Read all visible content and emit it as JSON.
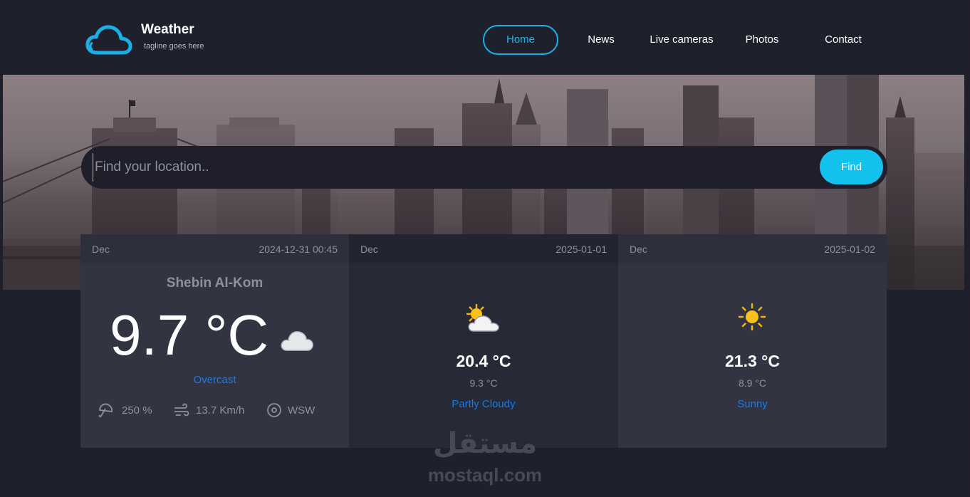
{
  "brand": {
    "title": "Weather",
    "tagline": "tagline goes here",
    "logo_icon": "cloud-icon",
    "accent": "#1ab0e6"
  },
  "nav": {
    "items": [
      {
        "label": "Home",
        "active": true
      },
      {
        "label": "News",
        "active": false
      },
      {
        "label": "Live cameras",
        "active": false
      },
      {
        "label": "Photos",
        "active": false
      },
      {
        "label": "Contact",
        "active": false
      }
    ]
  },
  "search": {
    "placeholder": "Find your location..",
    "button_label": "Find",
    "button_color": "#12c1ec"
  },
  "today": {
    "day": "Dec",
    "datetime": "2024-12-31 00:45",
    "city": "Shebin Al-Kom",
    "temp": "9.7 °C",
    "condition": "Overcast",
    "icon": "cloud-icon",
    "humidity": "250 %",
    "wind_speed": "13.7 Km/h",
    "wind_dir": "WSW"
  },
  "forecast": [
    {
      "day": "Dec",
      "date": "2025-01-01",
      "max": "20.4 °C",
      "min": "9.3 °C",
      "condition": "Partly Cloudy",
      "icon": "partly-cloudy-icon"
    },
    {
      "day": "Dec",
      "date": "2025-01-02",
      "max": "21.3 °C",
      "min": "8.9 °C",
      "condition": "Sunny",
      "icon": "sun-icon"
    }
  ],
  "watermark": {
    "arabic": "مستقل",
    "latin": "mostaql.com"
  },
  "colors": {
    "background": "#1e202c",
    "condition_text": "#1a7ae8",
    "muted_text": "#8e909a"
  }
}
